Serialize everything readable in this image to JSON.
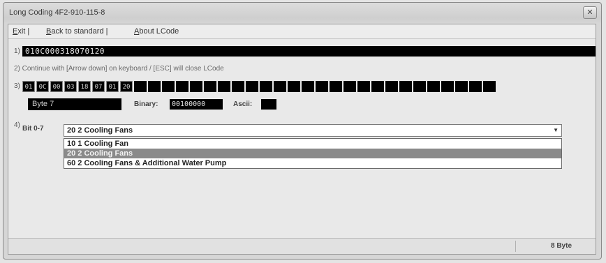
{
  "window": {
    "title": "Long Coding  4F2-910-115-8",
    "close_glyph": "✕"
  },
  "menu": [
    {
      "key": "E",
      "rest": "xit |"
    },
    {
      "key": "B",
      "rest": "ack to standard |"
    },
    {
      "key": "A",
      "rest": "bout LCode"
    }
  ],
  "step1": {
    "num": "1)",
    "code": "010C000318070120"
  },
  "step2": {
    "text": "2) Continue with [Arrow down] on keyboard / [ESC] will close LCode"
  },
  "step3": {
    "num": "3)",
    "bytes": [
      "01",
      "0C",
      "00",
      "03",
      "18",
      "07",
      "01",
      "20",
      "",
      "",
      "",
      "",
      "",
      "",
      "",
      "",
      "",
      "",
      "",
      "",
      "",
      "",
      "",
      "",
      "",
      "",
      "",
      "",
      "",
      "",
      "",
      "",
      "",
      ""
    ]
  },
  "byte_info": {
    "label": "Byte 7",
    "binary_label": "Binary:",
    "binary_value": "00100000",
    "ascii_label": "Ascii:"
  },
  "step4": {
    "num": "4)",
    "bit_label": "Bit 0-7",
    "selected": "20 2 Cooling Fans",
    "options": [
      "10 1 Cooling Fan",
      "20 2 Cooling Fans",
      "60 2 Cooling Fans & Additional Water Pump"
    ],
    "selected_index": 1
  },
  "status": {
    "size": "8 Byte"
  },
  "icons": {
    "dropdown_arrow": "chevron-down-icon",
    "close": "close-icon"
  }
}
